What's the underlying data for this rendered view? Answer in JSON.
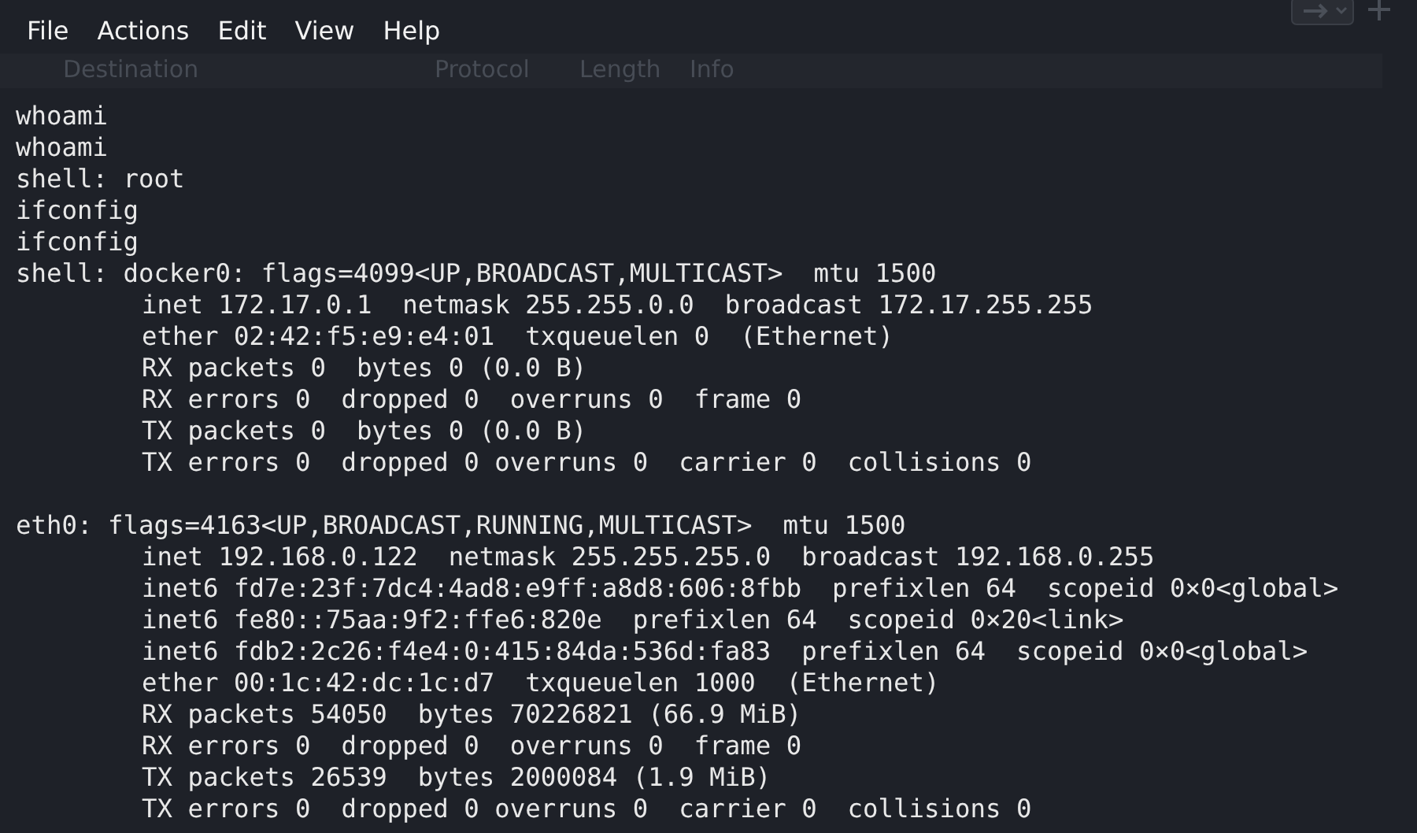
{
  "menu": [
    "File",
    "Actions",
    "Edit",
    "View",
    "Help"
  ],
  "packet_list_header": [
    "Destination",
    "Protocol",
    "Length",
    "Info"
  ],
  "terminal": {
    "blocks": [
      {
        "lines": [
          {
            "text": "whoami"
          },
          {
            "text": "whoami"
          },
          {
            "text": "shell: root"
          },
          {
            "text": "ifconfig"
          },
          {
            "text": "ifconfig"
          },
          {
            "text": "shell: docker0: flags=4099<UP,BROADCAST,MULTICAST>  mtu 1500",
            "children": [
              {
                "text": "inet 172.17.0.1  netmask 255.255.0.0  broadcast 172.17.255.255"
              },
              {
                "text": "ether 02:42:f5:e9:e4:01  txqueuelen 0  (Ethernet)"
              },
              {
                "text": "RX packets 0  bytes 0 (0.0 B)"
              },
              {
                "text": "RX errors 0  dropped 0  overruns 0  frame 0"
              },
              {
                "text": "TX packets 0  bytes 0 (0.0 B)"
              },
              {
                "text": "TX errors 0  dropped 0 overruns 0  carrier 0  collisions 0"
              }
            ]
          }
        ]
      },
      {
        "lines": [
          {
            "text": "eth0: flags=4163<UP,BROADCAST,RUNNING,MULTICAST>  mtu 1500",
            "children": [
              {
                "text": "inet 192.168.0.122  netmask 255.255.255.0  broadcast 192.168.0.255"
              },
              {
                "text": "inet6 fd7e:23f:7dc4:4ad8:e9ff:a8d8:606:8fbb  prefixlen 64  scopeid 0×0<global>"
              },
              {
                "text": "inet6 fe80::75aa:9f2:ffe6:820e  prefixlen 64  scopeid 0×20<link>"
              },
              {
                "text": "inet6 fdb2:2c26:f4e4:0:415:84da:536d:fa83  prefixlen 64  scopeid 0×0<global>"
              },
              {
                "text": "ether 00:1c:42:dc:1c:d7  txqueuelen 1000  (Ethernet)"
              },
              {
                "text": "RX packets 54050  bytes 70226821 (66.9 MiB)"
              },
              {
                "text": "RX errors 0  dropped 0  overruns 0  frame 0"
              },
              {
                "text": "TX packets 26539  bytes 2000084 (1.9 MiB)"
              },
              {
                "text": "TX errors 0  dropped 0 overruns 0  carrier 0  collisions 0"
              }
            ]
          }
        ]
      }
    ]
  }
}
